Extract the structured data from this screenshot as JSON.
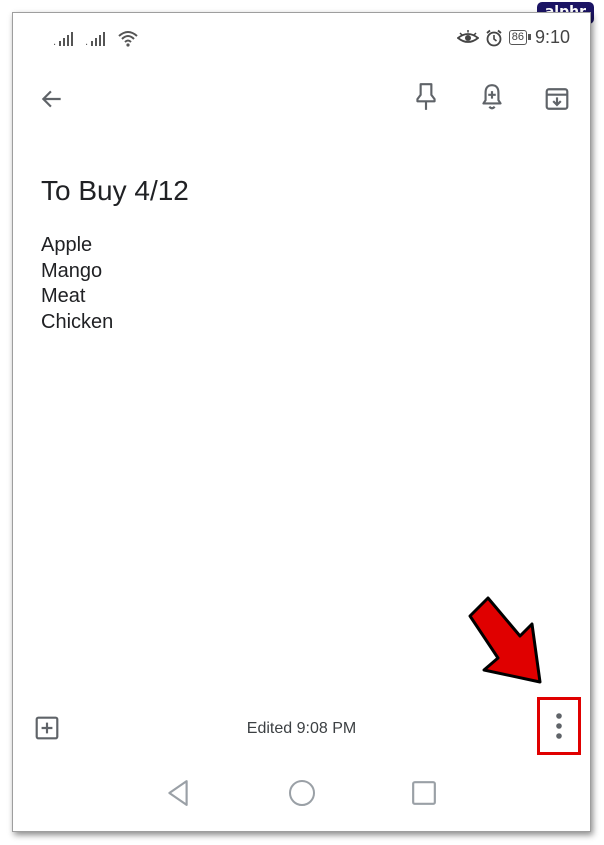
{
  "watermark": "alphr",
  "status_bar": {
    "battery_level": "86",
    "time": "9:10",
    "icons": [
      "signal-icon",
      "signal-icon",
      "wifi-icon",
      "eye-icon",
      "alarm-icon",
      "battery-icon"
    ]
  },
  "toolbar": {
    "icons": [
      "back-arrow-icon",
      "pin-icon",
      "reminder-bell-icon",
      "archive-icon"
    ]
  },
  "note": {
    "title": "To Buy 4/12",
    "lines": [
      "Apple",
      "Mango",
      "Meat",
      "Chicken"
    ]
  },
  "bottom_bar": {
    "edited_text": "Edited 9:08 PM",
    "icons": [
      "add-box-icon",
      "more-vert-icon"
    ]
  },
  "nav_bar": {
    "icons": [
      "nav-back-icon",
      "nav-home-icon",
      "nav-recents-icon"
    ]
  },
  "colors": {
    "highlight": "#e00000",
    "text": "#202124",
    "icon": "#5f6368"
  }
}
